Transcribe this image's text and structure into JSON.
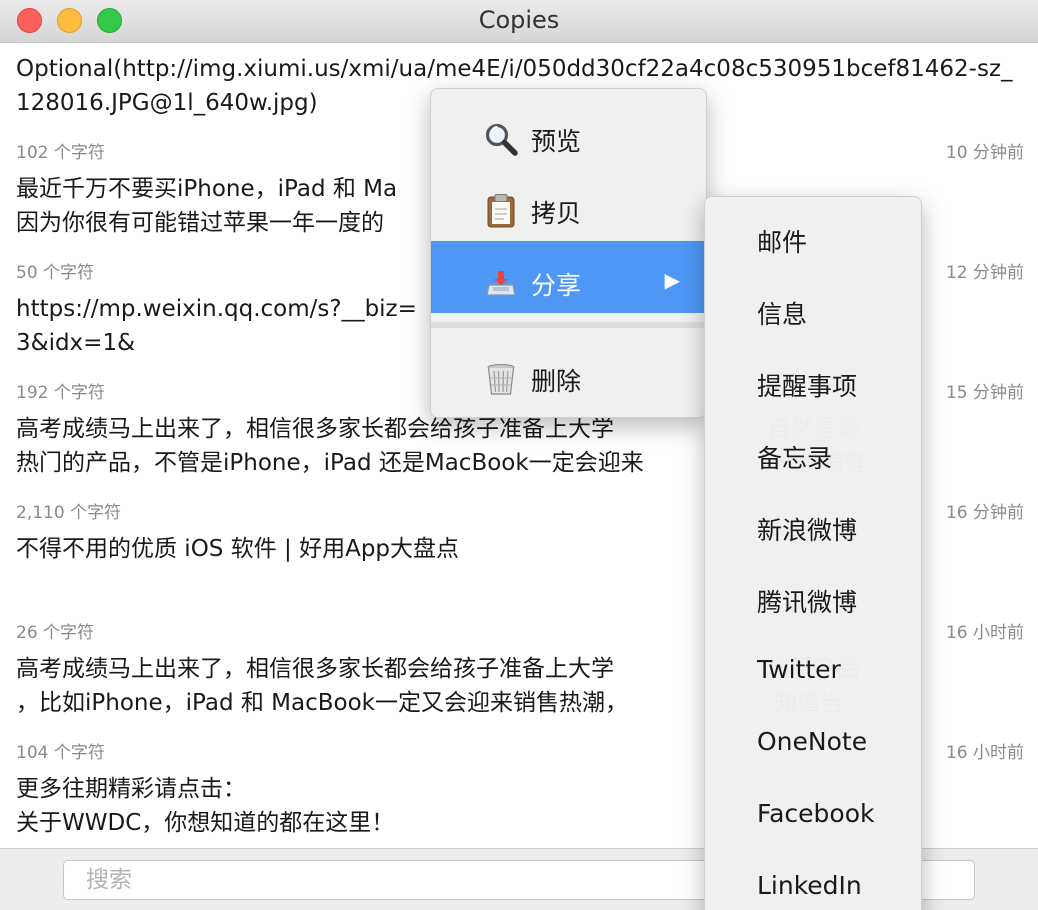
{
  "window": {
    "title": "Copies"
  },
  "entries": [
    {
      "text": "Optional(http://img.xiumi.us/xmi/ua/me4E/i/050dd30cf22a4c08c530951bcef81462-sz_128016.JPG@1l_640w.jpg)",
      "count": "102 个字符",
      "time": "10 分钟前"
    },
    {
      "text": "最近千万不要买iPhone，iPad 和 Ma\n因为你很有可能错过苹果一年一度的",
      "count": "50 个字符",
      "time": "12 分钟前"
    },
    {
      "text": "https://mp.weixin.qq.com/s?__biz=                                                                                       3&idx=1&\nsn=dbf3f243a04c7094bee6e35e0                                                                        69047…",
      "count": "192 个字符",
      "time": "15 分钟前"
    },
    {
      "text": "高考成绩马上出来了，相信很多家长都会给孩子准备上大学                     自然是最\n热门的产品，不管是iPhone，iPad 还是MacBook一定会迎来                     小编有…",
      "count": "2,110 个字符",
      "time": "16 分钟前"
    },
    {
      "text": "不得不用的优质 iOS 软件 | 好用App大盘点",
      "count": "26 个字符",
      "time": "16 小时前"
    },
    {
      "text": "高考成绩马上出来了，相信很多家长都会给孩子准备上大学                     热门产品\n，比如iPhone，iPad 和 MacBook一定又会迎来销售热潮，                    知道当…",
      "count": "104 个字符",
      "time": "16 小时前"
    },
    {
      "text": "更多往期精彩请点击：\n关于WWDC，你想知道的都在这里！",
      "count": "",
      "time": ""
    }
  ],
  "context_menu": {
    "items": [
      {
        "label": "预览",
        "icon": "magnifier-icon"
      },
      {
        "label": "拷贝",
        "icon": "clipboard-icon"
      },
      {
        "label": "分享",
        "icon": "share-tray-icon",
        "selected": true,
        "submenu": true
      },
      {
        "label": "删除",
        "icon": "trash-icon"
      }
    ],
    "selected_color": "#4f97f5"
  },
  "share_submenu": {
    "items": [
      "邮件",
      "信息",
      "提醒事项",
      "备忘录",
      "新浪微博",
      "腾讯微博",
      "Twitter",
      "OneNote",
      "Facebook",
      "LinkedIn"
    ]
  },
  "search": {
    "placeholder": "搜索",
    "value": ""
  }
}
